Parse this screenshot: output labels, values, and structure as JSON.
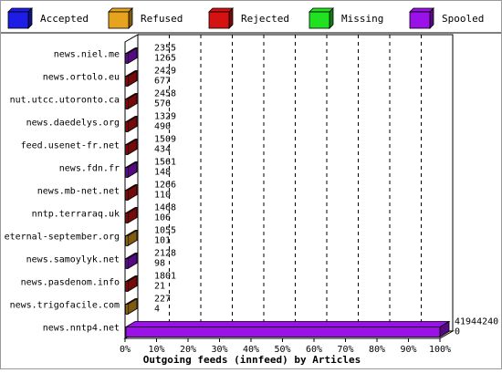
{
  "colors": {
    "accepted": "#1d1de6",
    "refused": "#e6a31d",
    "rejected": "#d41212",
    "missing": "#22e022",
    "spooled": "#9a12e8",
    "background": "#ffffff",
    "axis": "#000000"
  },
  "chart_data": {
    "type": "bar",
    "orientation": "horizontal",
    "title": "",
    "xlabel": "Outgoing feeds (innfeed) by Articles",
    "ylabel": "",
    "xlim": [
      0,
      100
    ],
    "x_tick_labels": [
      "0%",
      "10%",
      "20%",
      "30%",
      "40%",
      "50%",
      "60%",
      "70%",
      "80%",
      "90%",
      "100%"
    ],
    "grid": "vertical dashed",
    "legend_position": "top",
    "legend": [
      {
        "name": "Accepted",
        "color_key": "accepted"
      },
      {
        "name": "Refused",
        "color_key": "refused"
      },
      {
        "name": "Rejected",
        "color_key": "rejected"
      },
      {
        "name": "Missing",
        "color_key": "missing"
      },
      {
        "name": "Spooled",
        "color_key": "spooled"
      }
    ],
    "categories": [
      {
        "name": "news.niel.me",
        "offered": "2355",
        "accepted": "1265",
        "color_key": "spooled",
        "percent": 0.5
      },
      {
        "name": "news.ortolo.eu",
        "offered": "2429",
        "accepted": "677",
        "color_key": "rejected",
        "percent": 0.5
      },
      {
        "name": "nut.utcc.utoronto.ca",
        "offered": "2458",
        "accepted": "576",
        "color_key": "rejected",
        "percent": 0.5
      },
      {
        "name": "news.daedelys.org",
        "offered": "1329",
        "accepted": "490",
        "color_key": "rejected",
        "percent": 0.5
      },
      {
        "name": "feed.usenet-fr.net",
        "offered": "1509",
        "accepted": "434",
        "color_key": "rejected",
        "percent": 0.5
      },
      {
        "name": "news.fdn.fr",
        "offered": "1561",
        "accepted": "148",
        "color_key": "spooled",
        "percent": 0.5
      },
      {
        "name": "news.mb-net.net",
        "offered": "1266",
        "accepted": "110",
        "color_key": "rejected",
        "percent": 0.5
      },
      {
        "name": "nntp.terraraq.uk",
        "offered": "1468",
        "accepted": "106",
        "color_key": "rejected",
        "percent": 0.5
      },
      {
        "name": "eternal-september.org",
        "offered": "1055",
        "accepted": "101",
        "color_key": "refused",
        "percent": 0.5
      },
      {
        "name": "news.samoylyk.net",
        "offered": "2128",
        "accepted": "98",
        "color_key": "spooled",
        "percent": 0.5
      },
      {
        "name": "news.pasdenom.info",
        "offered": "1801",
        "accepted": "21",
        "color_key": "rejected",
        "percent": 0.5
      },
      {
        "name": "news.trigofacile.com",
        "offered": "227",
        "accepted": "4",
        "color_key": "refused",
        "percent": 0.5
      },
      {
        "name": "news.nntp4.net",
        "offered": "41944240",
        "accepted": "0",
        "color_key": "spooled",
        "percent": 100
      }
    ]
  }
}
